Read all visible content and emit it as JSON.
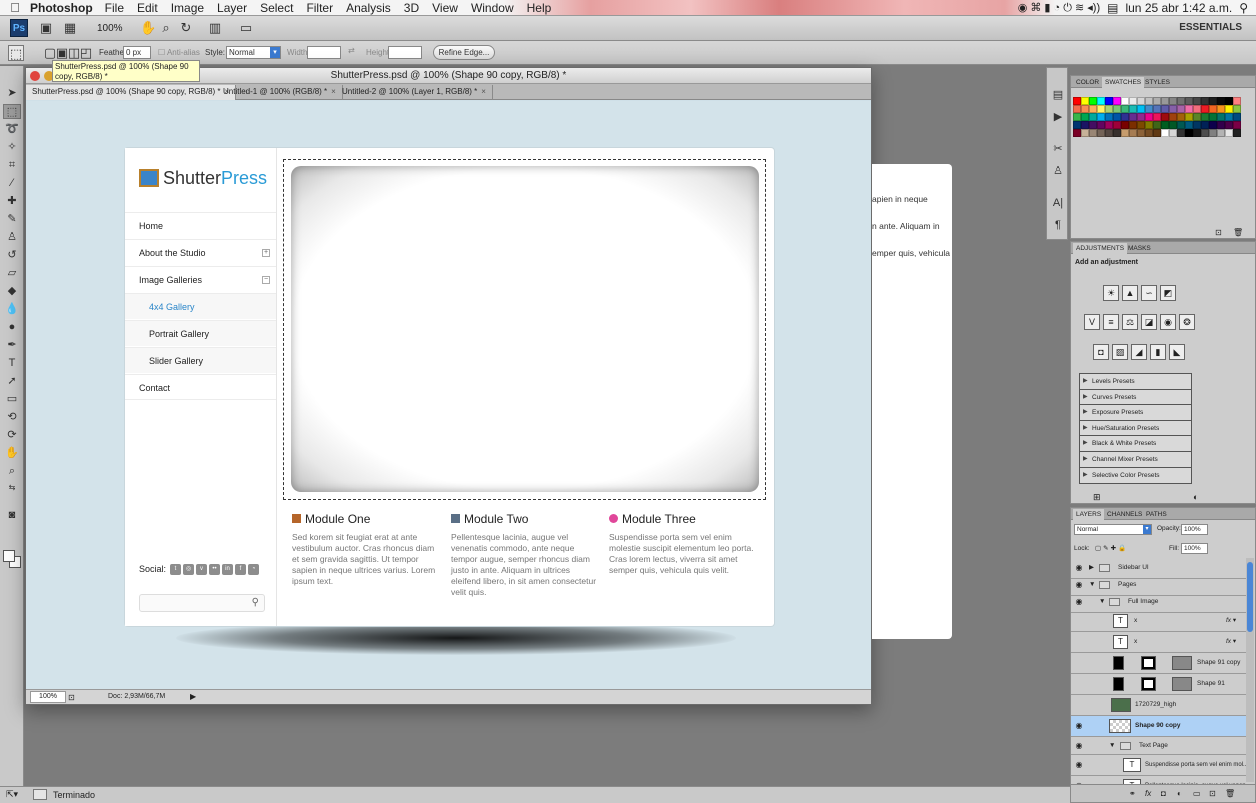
{
  "menubar": {
    "app": "Photoshop",
    "menus": [
      "File",
      "Edit",
      "Image",
      "Layer",
      "Select",
      "Filter",
      "Analysis",
      "3D",
      "View",
      "Window",
      "Help"
    ],
    "datetime": "lun 25 abr  1:42 a.m."
  },
  "appbar": {
    "logo": "Ps",
    "zoom": "100%",
    "workspace": "ESSENTIALS"
  },
  "options": {
    "feather_label": "Feather:",
    "feather_value": "0 px",
    "antialias_label": "Anti-alias",
    "style_label": "Style:",
    "style_value": "Normal",
    "width_label": "Width:",
    "height_label": "Height:",
    "refine_button": "Refine Edge..."
  },
  "tooltip": "ShutterPress.psd @ 100% (Shape 90 copy, RGB/8) *",
  "document": {
    "title": "ShutterPress.psd @ 100% (Shape 90 copy, RGB/8) *",
    "tabs": [
      {
        "label": "ShutterPress.psd @ 100% (Shape 90 copy, RGB/8) *"
      },
      {
        "label": "Untitled-1 @ 100% (RGB/8) *"
      },
      {
        "label": "Untitled-2 @ 100% (Layer 1, RGB/8) *"
      }
    ],
    "zoom": "100%",
    "doc_size": "Doc: 2,93M/66,7M"
  },
  "site": {
    "logo_a": "Shutter",
    "logo_b": "Press",
    "nav": [
      {
        "label": "Home"
      },
      {
        "label": "About the Studio",
        "toggle": "+"
      },
      {
        "label": "Image Galleries",
        "toggle": "−"
      },
      {
        "label": "4x4 Gallery"
      },
      {
        "label": "Portrait Gallery"
      },
      {
        "label": "Slider Gallery"
      },
      {
        "label": "Contact"
      }
    ],
    "social_label": "Social:",
    "modules": [
      {
        "title": "Module One",
        "body": "Sed korem sit feugiat erat at ante vestibulum auctor. Cras rhoncus diam et sem gravida sagittis. Ut tempor sapien in neque ultrices varius. Lorem ipsum text.",
        "icon_color": "#b5652a"
      },
      {
        "title": "Module Two",
        "body": "Pellentesque lacinia, augue vel venenatis commodo, ante neque tempor augue, semper rhoncus diam justo in ante. Aliquam in ultrices eleifend libero, in sit amen consectetur velit quis.",
        "icon_color": "#5a6f86"
      },
      {
        "title": "Module Three",
        "body": "Suspendisse porta sem vel enim molestie suscipit elementum leo porta. Cras lorem lectus, viverra sit amet semper quis, vehicula quis velit.",
        "icon_color": "#e0479a"
      }
    ]
  },
  "back_page": {
    "lines": [
      "apien in neque",
      "n ante. Aliquam in",
      "emper quis, vehicula"
    ]
  },
  "color_panel": {
    "tabs": [
      "COLOR",
      "SWATCHES",
      "STYLES"
    ]
  },
  "adjustments": {
    "tabs": [
      "ADJUSTMENTS",
      "MASKS"
    ],
    "heading": "Add an adjustment",
    "presets": [
      "Levels Presets",
      "Curves Presets",
      "Exposure Presets",
      "Hue/Saturation Presets",
      "Black & White Presets",
      "Channel Mixer Presets",
      "Selective Color Presets"
    ]
  },
  "layers": {
    "tabs": [
      "LAYERS",
      "CHANNELS",
      "PATHS"
    ],
    "blend_mode": "Normal",
    "opacity_label": "Opacity:",
    "opacity": "100%",
    "lock_label": "Lock:",
    "fill_label": "Fill:",
    "fill": "100%",
    "rows": [
      {
        "name": "Sidebar UI",
        "kind": "group"
      },
      {
        "name": "Pages",
        "kind": "group"
      },
      {
        "name": "Full Image",
        "kind": "group"
      },
      {
        "name": "x",
        "kind": "text"
      },
      {
        "name": "x",
        "kind": "text"
      },
      {
        "name": "Shape 91 copy",
        "kind": "shape"
      },
      {
        "name": "Shape 91",
        "kind": "shape"
      },
      {
        "name": "1720729_high",
        "kind": "image"
      },
      {
        "name": "Shape 90 copy",
        "kind": "selected"
      },
      {
        "name": "Text Page",
        "kind": "group"
      },
      {
        "name": "Suspendisse porta sem vel enim mol...",
        "kind": "text"
      },
      {
        "name": "Pellentesque lacinia, augue vel venen...",
        "kind": "text"
      }
    ]
  },
  "status": {
    "label": "Terminado"
  },
  "colors": {
    "selection_blue": "#aed1f5",
    "link_blue": "#2a86c9"
  }
}
